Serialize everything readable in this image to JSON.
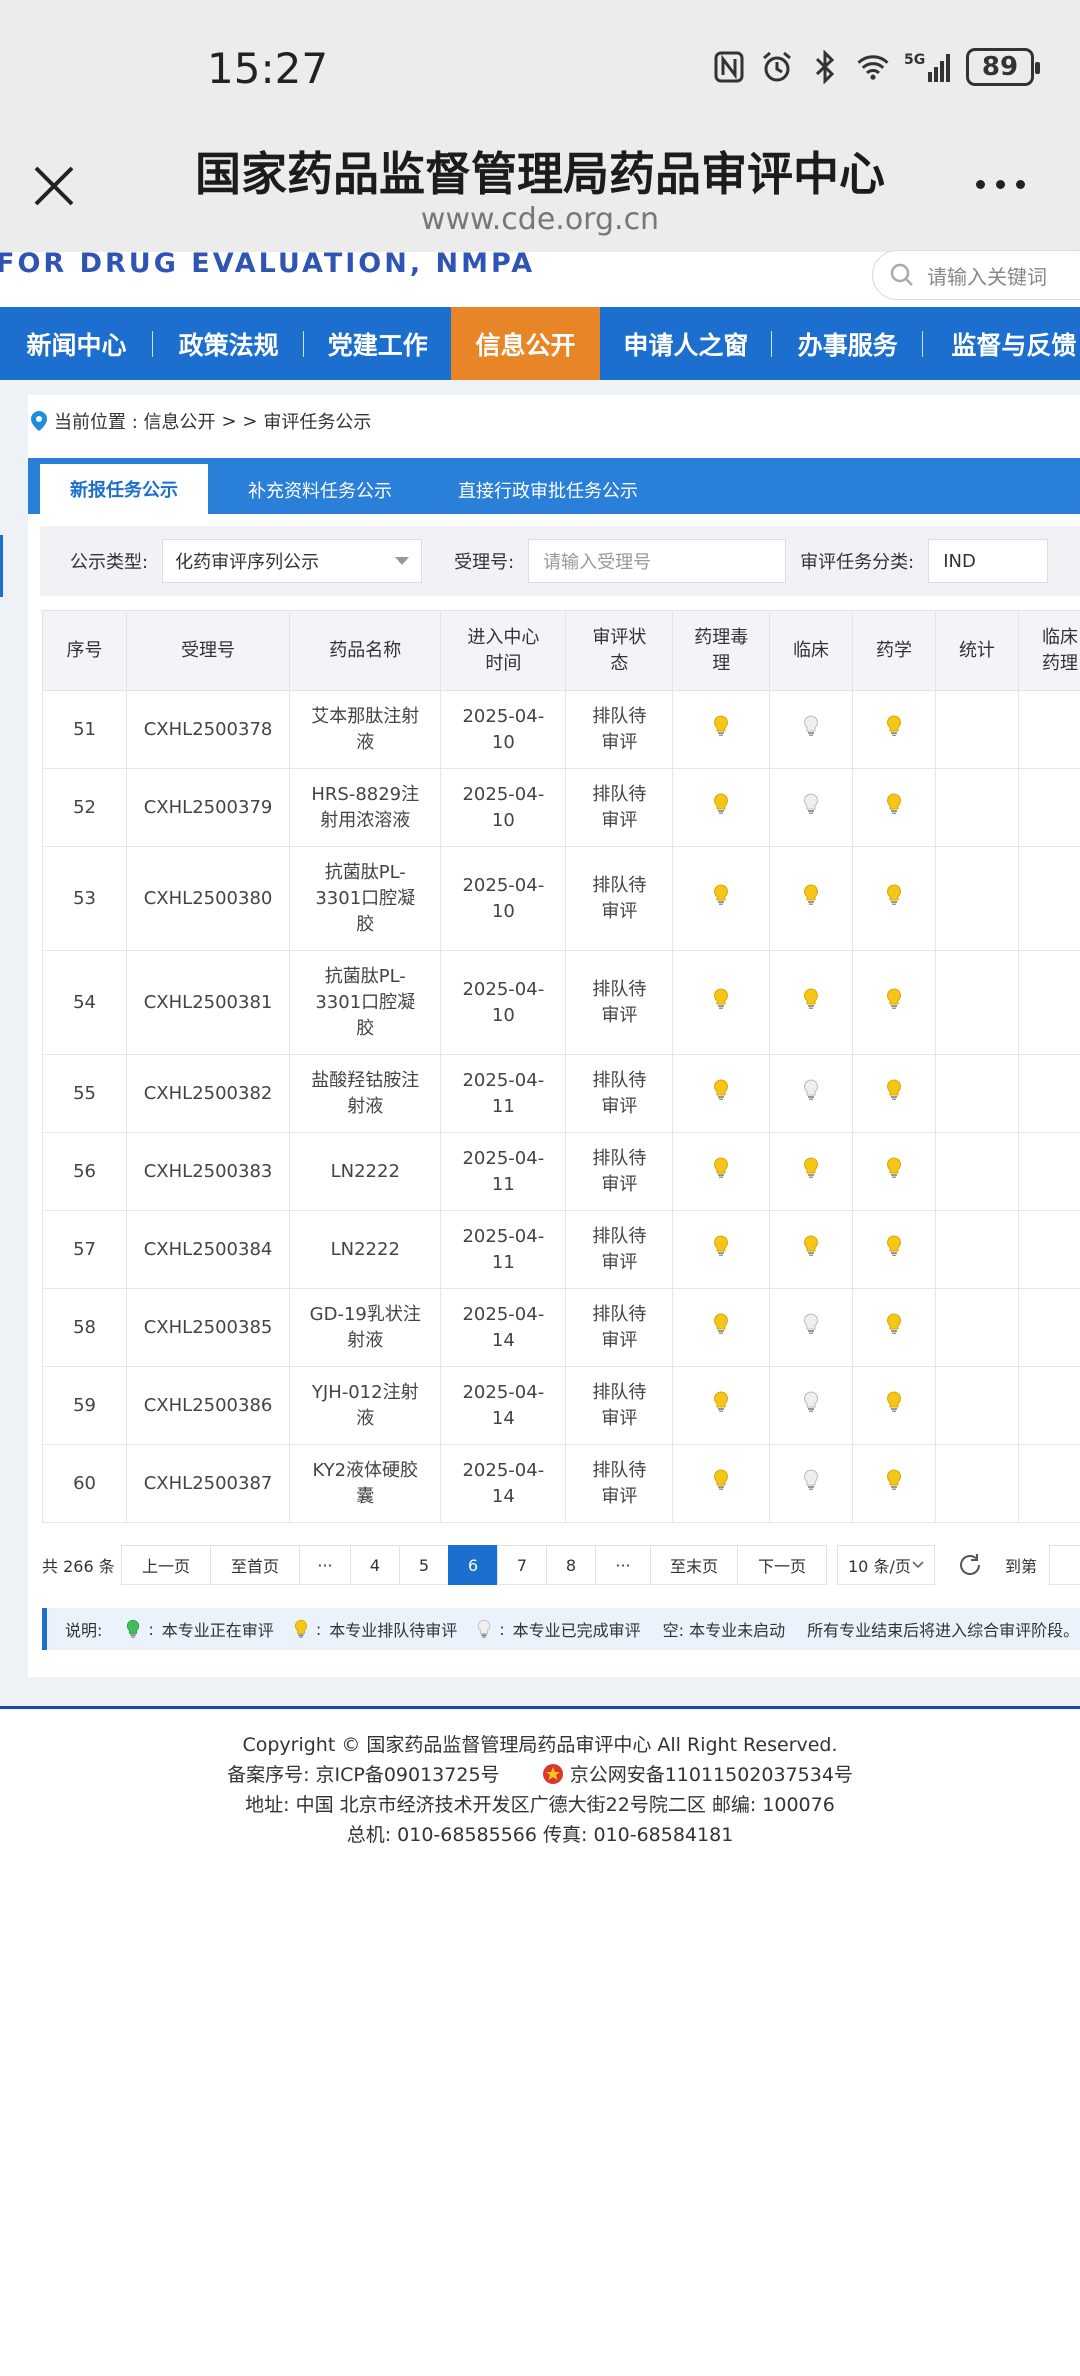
{
  "status": {
    "time": "15:27",
    "battery": "89",
    "net": "5G"
  },
  "browser": {
    "title": "国家药品监督管理局药品审评中心",
    "url": "www.cde.org.cn"
  },
  "site": {
    "eng": "FOR DRUG EVALUATION, NMPA",
    "search_placeholder": "请输入关键词"
  },
  "nav": [
    {
      "label": "新闻中心",
      "active": false
    },
    {
      "label": "政策法规",
      "active": false
    },
    {
      "label": "党建工作",
      "active": false
    },
    {
      "label": "信息公开",
      "active": true
    },
    {
      "label": "申请人之窗",
      "active": false
    },
    {
      "label": "办事服务",
      "active": false
    },
    {
      "label": "监督与反馈",
      "active": false
    }
  ],
  "breadcrumb": {
    "prefix": "当前位置 : 信息公开",
    "sep": "> >",
    "current": "审评任务公示"
  },
  "tabs": [
    "新报任务公示",
    "补充资料任务公示",
    "直接行政审批任务公示"
  ],
  "filters": {
    "type_label": "公示类型:",
    "type_value": "化药审评序列公示",
    "no_label": "受理号:",
    "no_placeholder": "请输入受理号",
    "cat_label": "审评任务分类:",
    "cat_value": "IND"
  },
  "table": {
    "headers": [
      "序号",
      "受理号",
      "药品名称",
      "进入中心时间",
      "审评状态",
      "药理毒理",
      "临床",
      "药学",
      "统计",
      "临床药理"
    ],
    "header_lines": [
      [
        "序号"
      ],
      [
        "受理号"
      ],
      [
        "药品名称"
      ],
      [
        "进入中心",
        "时间"
      ],
      [
        "审评状",
        "态"
      ],
      [
        "药理毒",
        "理"
      ],
      [
        "临床"
      ],
      [
        "药学"
      ],
      [
        "统计"
      ],
      [
        "临床",
        "药理"
      ]
    ],
    "rows": [
      {
        "no": "51",
        "id": "CXHL2500378",
        "name": [
          "艾本那肽注射",
          "液"
        ],
        "date": [
          "2025-04-",
          "10"
        ],
        "status": [
          "排队待",
          "审评"
        ],
        "pharm": "yellow",
        "clin": "white",
        "chem": "yellow"
      },
      {
        "no": "52",
        "id": "CXHL2500379",
        "name": [
          "HRS-8829注",
          "射用浓溶液"
        ],
        "date": [
          "2025-04-",
          "10"
        ],
        "status": [
          "排队待",
          "审评"
        ],
        "pharm": "yellow",
        "clin": "white",
        "chem": "yellow"
      },
      {
        "no": "53",
        "id": "CXHL2500380",
        "name": [
          "抗菌肽PL-",
          "3301口腔凝",
          "胶"
        ],
        "date": [
          "2025-04-",
          "10"
        ],
        "status": [
          "排队待",
          "审评"
        ],
        "pharm": "yellow",
        "clin": "yellow",
        "chem": "yellow"
      },
      {
        "no": "54",
        "id": "CXHL2500381",
        "name": [
          "抗菌肽PL-",
          "3301口腔凝",
          "胶"
        ],
        "date": [
          "2025-04-",
          "10"
        ],
        "status": [
          "排队待",
          "审评"
        ],
        "pharm": "yellow",
        "clin": "yellow",
        "chem": "yellow"
      },
      {
        "no": "55",
        "id": "CXHL2500382",
        "name": [
          "盐酸羟钴胺注",
          "射液"
        ],
        "date": [
          "2025-04-",
          "11"
        ],
        "status": [
          "排队待",
          "审评"
        ],
        "pharm": "yellow",
        "clin": "white",
        "chem": "yellow"
      },
      {
        "no": "56",
        "id": "CXHL2500383",
        "name": [
          "LN2222"
        ],
        "date": [
          "2025-04-",
          "11"
        ],
        "status": [
          "排队待",
          "审评"
        ],
        "pharm": "yellow",
        "clin": "yellow",
        "chem": "yellow"
      },
      {
        "no": "57",
        "id": "CXHL2500384",
        "name": [
          "LN2222"
        ],
        "date": [
          "2025-04-",
          "11"
        ],
        "status": [
          "排队待",
          "审评"
        ],
        "pharm": "yellow",
        "clin": "yellow",
        "chem": "yellow"
      },
      {
        "no": "58",
        "id": "CXHL2500385",
        "name": [
          "GD-19乳状注",
          "射液"
        ],
        "date": [
          "2025-04-",
          "14"
        ],
        "status": [
          "排队待",
          "审评"
        ],
        "pharm": "yellow",
        "clin": "white",
        "chem": "yellow"
      },
      {
        "no": "59",
        "id": "CXHL2500386",
        "name": [
          "YJH-012注射",
          "液"
        ],
        "date": [
          "2025-04-",
          "14"
        ],
        "status": [
          "排队待",
          "审评"
        ],
        "pharm": "yellow",
        "clin": "white",
        "chem": "yellow"
      },
      {
        "no": "60",
        "id": "CXHL2500387",
        "name": [
          "KY2液体硬胶",
          "囊"
        ],
        "date": [
          "2025-04-",
          "14"
        ],
        "status": [
          "排队待",
          "审评"
        ],
        "pharm": "yellow",
        "clin": "white",
        "chem": "yellow"
      }
    ]
  },
  "pager": {
    "total": "共 266 条",
    "prev": "上一页",
    "first": "至首页",
    "ellipsis": "···",
    "pages": [
      "4",
      "5",
      "6",
      "7",
      "8"
    ],
    "current": "6",
    "last": "至末页",
    "next": "下一页",
    "per_page": "10 条/页",
    "goto": "到第"
  },
  "legend": {
    "title": "说明:",
    "green": "本专业正在审评",
    "yellow": "本专业排队待审评",
    "white": "本专业已完成审评",
    "empty": "空:  本专业未启动",
    "note": "所有专业结束后将进入综合审评阶段。",
    "colon": ":"
  },
  "footer": {
    "copyright": "Copyright © 国家药品监督管理局药品审评中心   All Right Reserved.",
    "icp": "备案序号:  京ICP备09013725号",
    "police": "京公网安备11011502037534号",
    "address": "地址:  中国 北京市经济技术开发区广德大街22号院二区        邮编:  100076",
    "phone": "总机:  010-68585566        传真:  010-68584181"
  },
  "colors": {
    "nav_blue": "#1c6fcf",
    "nav_active": "#e88526",
    "bulb_yellow": "#f5c518",
    "bulb_white": "#e6e6e6",
    "bulb_green": "#3fbf5a"
  }
}
